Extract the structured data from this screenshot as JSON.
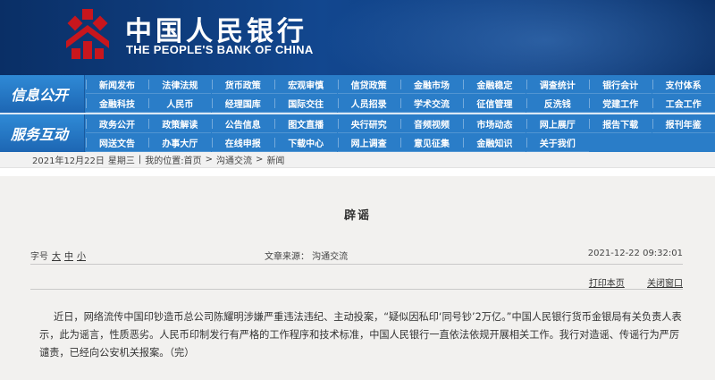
{
  "header": {
    "logo_cn": "中国人民银行",
    "logo_en": "THE PEOPLE'S BANK OF CHINA",
    "brand_color": "#c8161d",
    "banner_color": "#0a2f66"
  },
  "nav": {
    "accent": "#2a7dc8",
    "info_title": "信息公开",
    "service_title": "服务互动",
    "info_items": [
      "新闻发布",
      "法律法规",
      "货币政策",
      "宏观审慎",
      "信贷政策",
      "金融市场",
      "金融稳定",
      "调查统计",
      "银行会计",
      "支付体系",
      "金融科技",
      "人民币",
      "经理国库",
      "国际交往",
      "人员招录",
      "学术交流",
      "征信管理",
      "反洗钱",
      "党建工作",
      "工会工作"
    ],
    "service_items": [
      "政务公开",
      "政策解读",
      "公告信息",
      "图文直播",
      "央行研究",
      "音频视频",
      "市场动态",
      "网上展厅",
      "报告下载",
      "报刊年鉴",
      "网送文告",
      "办事大厅",
      "在线申报",
      "下载中心",
      "网上调查",
      "意见征集",
      "金融知识",
      "关于我们"
    ]
  },
  "breadcrumb": {
    "date": "2021年12月22日",
    "weekday": "星期三",
    "sep": "|",
    "location_label": "我的位置:",
    "home": "首页",
    "arrow": ">",
    "section": "沟通交流",
    "page": "新闻"
  },
  "article": {
    "title": "辟谣",
    "size_label": "字号",
    "size_large": "大",
    "size_medium": "中",
    "size_small": "小",
    "source": "文章来源：  沟通交流",
    "datetime": "2021-12-22 09:32:01",
    "print_label": "打印本页",
    "close_label": "关闭窗口",
    "body": "近日，网络流传中国印钞造币总公司陈耀明涉嫌严重违法违纪、主动投案，“疑似因私印‘同号钞’2万亿。”中国人民银行货币金银局有关负责人表示，此为谣言，性质恶劣。人民币印制发行有严格的工作程序和技术标准，中国人民银行一直依法依规开展相关工作。我行对造谣、传谣行为严厉谴责，已经向公安机关报案。（完）"
  }
}
